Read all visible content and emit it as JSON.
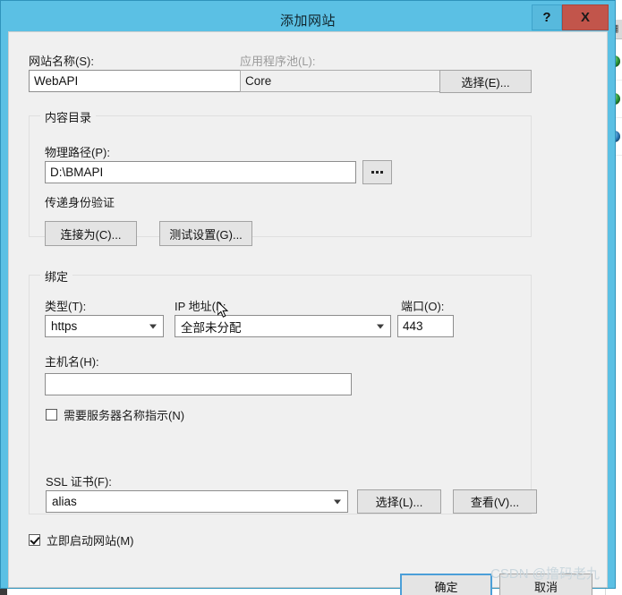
{
  "dialog": {
    "title": "添加网站",
    "help_button": "?",
    "close_button": "X"
  },
  "site_name": {
    "label": "网站名称(S):",
    "value": "WebAPI"
  },
  "app_pool": {
    "label": "应用程序池(L):",
    "value": "Core",
    "select_button": "选择(E)..."
  },
  "content_directory": {
    "group_title": "内容目录",
    "physical_path_label": "物理路径(P):",
    "physical_path_value": "D:\\BMAPI",
    "browse_button": "...",
    "passthrough_auth_label": "传递身份验证",
    "connect_as_button": "连接为(C)...",
    "test_settings_button": "测试设置(G)..."
  },
  "binding": {
    "group_title": "绑定",
    "type_label": "类型(T):",
    "type_value": "https",
    "ip_label": "IP 地址(I):",
    "ip_value": "全部未分配",
    "port_label": "端口(O):",
    "port_value": "443",
    "hostname_label": "主机名(H):",
    "hostname_value": "",
    "hostname_placeholder": "",
    "sni_label": "需要服务器名称指示(N)",
    "sni_checked": false,
    "ssl_cert_label": "SSL 证书(F):",
    "ssl_cert_value": "alias",
    "ssl_select_button": "选择(L)...",
    "ssl_view_button": "查看(V)..."
  },
  "footer": {
    "start_now_label": "立即启动网站(M)",
    "start_now_checked": true,
    "ok_button": "确定",
    "cancel_button": "取消"
  },
  "watermark": {
    "text": "CSDN @撸码老九"
  },
  "background": {
    "panel_glyph": "▦"
  },
  "colors": {
    "title_bar": "#5bc0e4",
    "close_button": "#c2554b",
    "dialog_body": "#f0f0f0",
    "focus_border": "#4b9fd8"
  }
}
